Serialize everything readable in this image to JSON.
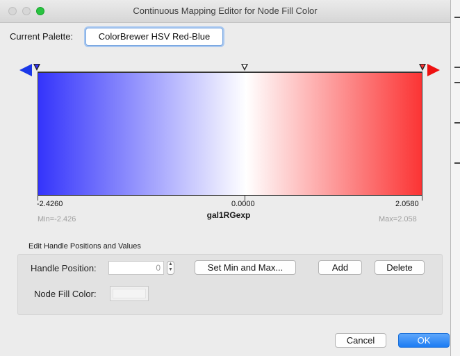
{
  "window": {
    "title": "Continuous Mapping Editor for Node Fill Color"
  },
  "palette": {
    "label": "Current Palette:",
    "value": "ColorBrewer HSV Red-Blue"
  },
  "gradient": {
    "min_color": "#3434fb",
    "mid_color": "#ffffff",
    "max_color": "#fb3434",
    "left_arrow_color": "#1b38e8",
    "right_arrow_color": "#ee1111"
  },
  "axis": {
    "min_value": "-2.4260",
    "mid_value": "0.0000",
    "max_value": "2.0580",
    "min_label": "Min=-2.426",
    "max_label": "Max=2.058",
    "attribute": "gal1RGexp"
  },
  "edit": {
    "section_title": "Edit Handle Positions and Values",
    "handle_position_label": "Handle Position:",
    "handle_position_value": "0",
    "set_min_max_label": "Set Min and Max...",
    "add_label": "Add",
    "delete_label": "Delete",
    "fill_color_label": "Node Fill Color:"
  },
  "footer": {
    "cancel_label": "Cancel",
    "ok_label": "OK"
  }
}
